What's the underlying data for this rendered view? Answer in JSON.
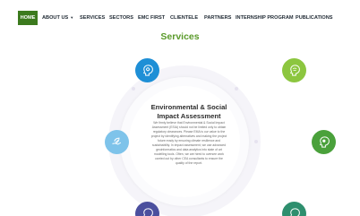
{
  "nav": {
    "items": [
      {
        "label": "HOME",
        "active": true
      },
      {
        "label": "ABOUT US",
        "has_dropdown": true
      },
      {
        "label": "SERVICES"
      },
      {
        "label": "SECTORS"
      },
      {
        "label": "EMC FIRST"
      },
      {
        "label": "CLIENTELE"
      },
      {
        "label": "PARTNERS"
      },
      {
        "label": "INTERNSHIP PROGRAM"
      },
      {
        "label": "PUBLICATIONS"
      }
    ],
    "dropdown_glyph": "▼",
    "active_color": "#3c7a1e"
  },
  "page": {
    "title": "Services",
    "title_color": "#5a9a2a"
  },
  "center": {
    "title": "Environmental & Social Impact Assessment",
    "body": "We firmly believe that Environmental & Social Impact Assessment (ESIA) should not be limited only to obtain regulatory clearances. Please EMA is our value to the project by identifying alternatives and making the project future ready by ensuring climate resilience and sustainability. In impact assessment, we use advanced geoinformatics and data analytics into state of art modelling tools. Often, we are hired to oversee work carried out by other CEA consultants to ensure the quality of the report."
  },
  "icons": [
    {
      "name": "head-mind-icon",
      "color": "#1e8fd6"
    },
    {
      "name": "head-mind-icon",
      "color": "#8cc63f"
    },
    {
      "name": "hand-leaf-icon",
      "color": "#7ec3ea"
    },
    {
      "name": "head-mind-icon",
      "color": "#4aa13b"
    },
    {
      "name": "head-mind-icon",
      "color": "#4b4f9e"
    },
    {
      "name": "head-mind-icon",
      "color": "#2e8f6e"
    }
  ]
}
